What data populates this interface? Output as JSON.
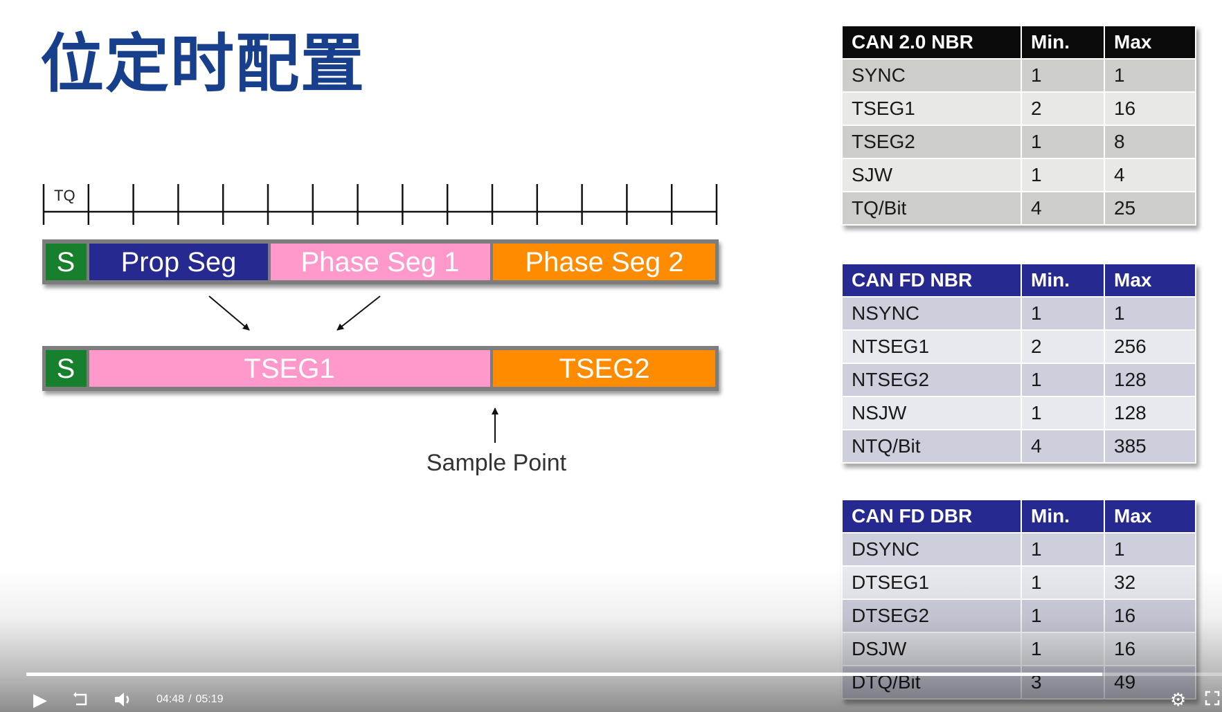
{
  "slide": {
    "title": "位定时配置",
    "diagram": {
      "tq_label": "TQ",
      "top_bar": {
        "s": "S",
        "prop_seg": "Prop Seg",
        "phase_seg_1": "Phase Seg 1",
        "phase_seg_2": "Phase Seg 2"
      },
      "bottom_bar": {
        "s": "S",
        "tseg1": "TSEG1",
        "tseg2": "TSEG2"
      },
      "sample_point": "Sample Point",
      "colors": {
        "sync": "#16802c",
        "prop": "#26298f",
        "phase1": "#ff99cc",
        "phase2": "#ff8c00",
        "frame": "#7d7d7d"
      }
    },
    "tables": [
      {
        "headers": [
          "CAN 2.0 NBR",
          "Min.",
          "Max"
        ],
        "rows": [
          [
            "SYNC",
            "1",
            "1"
          ],
          [
            "TSEG1",
            "2",
            "16"
          ],
          [
            "TSEG2",
            "1",
            "8"
          ],
          [
            "SJW",
            "1",
            "4"
          ],
          [
            "TQ/Bit",
            "4",
            "25"
          ]
        ]
      },
      {
        "headers": [
          "CAN FD NBR",
          "Min.",
          "Max"
        ],
        "rows": [
          [
            "NSYNC",
            "1",
            "1"
          ],
          [
            "NTSEG1",
            "2",
            "256"
          ],
          [
            "NTSEG2",
            "1",
            "128"
          ],
          [
            "NSJW",
            "1",
            "128"
          ],
          [
            "NTQ/Bit",
            "4",
            "385"
          ]
        ]
      },
      {
        "headers": [
          "CAN FD DBR",
          "Min.",
          "Max"
        ],
        "rows": [
          [
            "DSYNC",
            "1",
            "1"
          ],
          [
            "DTSEG1",
            "1",
            "32"
          ],
          [
            "DTSEG2",
            "1",
            "16"
          ],
          [
            "DSJW",
            "1",
            "16"
          ],
          [
            "DTQ/Bit",
            "3",
            "49"
          ]
        ]
      }
    ]
  },
  "player": {
    "current_time": "04:48",
    "separator": "/",
    "duration": "05:19",
    "progress": 0.9,
    "icons": {
      "play": "play-icon",
      "replay": "replay-10-icon",
      "volume": "volume-icon",
      "settings": "gear-icon",
      "fullscreen": "fullscreen-icon"
    }
  }
}
